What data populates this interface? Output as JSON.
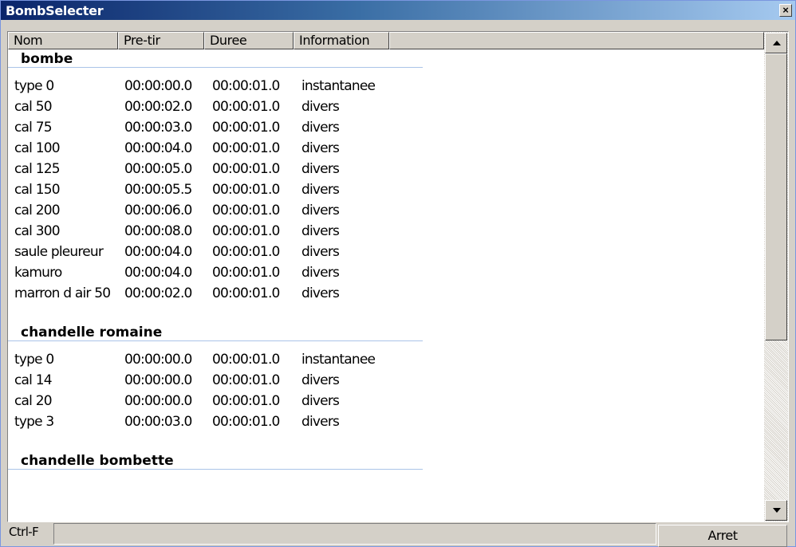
{
  "window": {
    "title": "BombSelecter",
    "close_label": "×"
  },
  "columns": [
    "Nom",
    "Pre-tir",
    "Duree",
    "Information"
  ],
  "groups": [
    {
      "name": "bombe",
      "rows": [
        [
          "type 0",
          "00:00:00.0",
          "00:00:01.0",
          "instantanee"
        ],
        [
          "cal 50",
          "00:00:02.0",
          "00:00:01.0",
          "divers"
        ],
        [
          "cal 75",
          "00:00:03.0",
          "00:00:01.0",
          "divers"
        ],
        [
          "cal 100",
          "00:00:04.0",
          "00:00:01.0",
          "divers"
        ],
        [
          "cal 125",
          "00:00:05.0",
          "00:00:01.0",
          "divers"
        ],
        [
          "cal 150",
          "00:00:05.5",
          "00:00:01.0",
          "divers"
        ],
        [
          "cal 200",
          "00:00:06.0",
          "00:00:01.0",
          "divers"
        ],
        [
          "cal 300",
          "00:00:08.0",
          "00:00:01.0",
          "divers"
        ],
        [
          "saule pleureur",
          "00:00:04.0",
          "00:00:01.0",
          "divers"
        ],
        [
          "kamuro",
          "00:00:04.0",
          "00:00:01.0",
          "divers"
        ],
        [
          "marron d air 50",
          "00:00:02.0",
          "00:00:01.0",
          "divers"
        ]
      ]
    },
    {
      "name": "chandelle romaine",
      "rows": [
        [
          "type 0",
          "00:00:00.0",
          "00:00:01.0",
          "instantanee"
        ],
        [
          "cal 14",
          "00:00:00.0",
          "00:00:01.0",
          "divers"
        ],
        [
          "cal 20",
          "00:00:00.0",
          "00:00:01.0",
          "divers"
        ],
        [
          "type 3",
          "00:00:03.0",
          "00:00:01.0",
          "divers"
        ]
      ]
    },
    {
      "name": "chandelle bombette",
      "rows": []
    }
  ],
  "scrollbar": {
    "up_icon": "arrow-up-icon",
    "down_icon": "arrow-down-icon"
  },
  "status": {
    "shortcut_label": "Ctrl-F",
    "search_value": "",
    "stop_button": "Arret"
  }
}
